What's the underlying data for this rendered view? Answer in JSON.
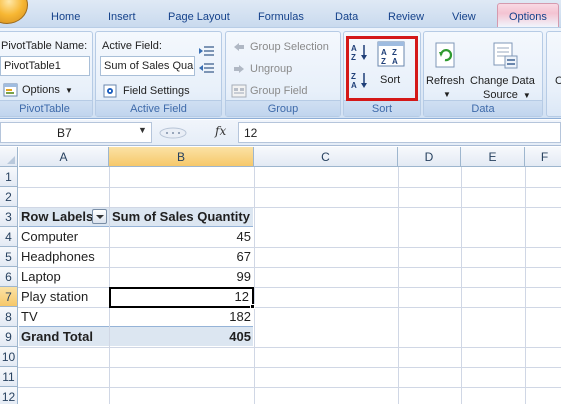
{
  "tabs": [
    {
      "label": "Home"
    },
    {
      "label": "Insert"
    },
    {
      "label": "Page Layout"
    },
    {
      "label": "Formulas"
    },
    {
      "label": "Data"
    },
    {
      "label": "Review"
    },
    {
      "label": "View"
    },
    {
      "label": "Options"
    }
  ],
  "ribbon": {
    "pivottable": {
      "name_label": "PivotTable Name:",
      "name_value": "PivotTable1",
      "options_label": "Options",
      "group_label": "PivotTable"
    },
    "active_field": {
      "label": "Active Field:",
      "value": "Sum of Sales Qua",
      "field_settings_label": "Field Settings",
      "group_label": "Active Field"
    },
    "group": {
      "group_selection_label": "Group Selection",
      "ungroup_label": "Ungroup",
      "group_field_label": "Group Field",
      "group_label": "Group"
    },
    "sort": {
      "sort_label": "Sort",
      "group_label": "Sort"
    },
    "data": {
      "refresh_label": "Refresh",
      "change_source_line1": "Change Data",
      "change_source_line2": "Source",
      "group_label": "Data"
    },
    "highlight_color": "#d41818"
  },
  "formula_bar": {
    "name_box": "B7",
    "fx_label": "fx",
    "formula": "12"
  },
  "grid": {
    "columns": [
      "A",
      "B",
      "C",
      "D",
      "E",
      "F"
    ],
    "active_column": "B",
    "rows": [
      "1",
      "2",
      "3",
      "4",
      "5",
      "6",
      "7",
      "8",
      "9",
      "10",
      "11",
      "12"
    ],
    "active_row": "7",
    "header_row": {
      "row_labels": "Row Labels",
      "value_header": "Sum of Sales Quantity"
    },
    "items": [
      {
        "label": "Computer",
        "value": "45"
      },
      {
        "label": "Headphones",
        "value": "67"
      },
      {
        "label": "Laptop",
        "value": "99"
      },
      {
        "label": "Play station",
        "value": "12"
      },
      {
        "label": "TV",
        "value": "182"
      }
    ],
    "grand_total": {
      "label": "Grand Total",
      "value": "405"
    },
    "pivot_band_color": "#dce6f1"
  }
}
